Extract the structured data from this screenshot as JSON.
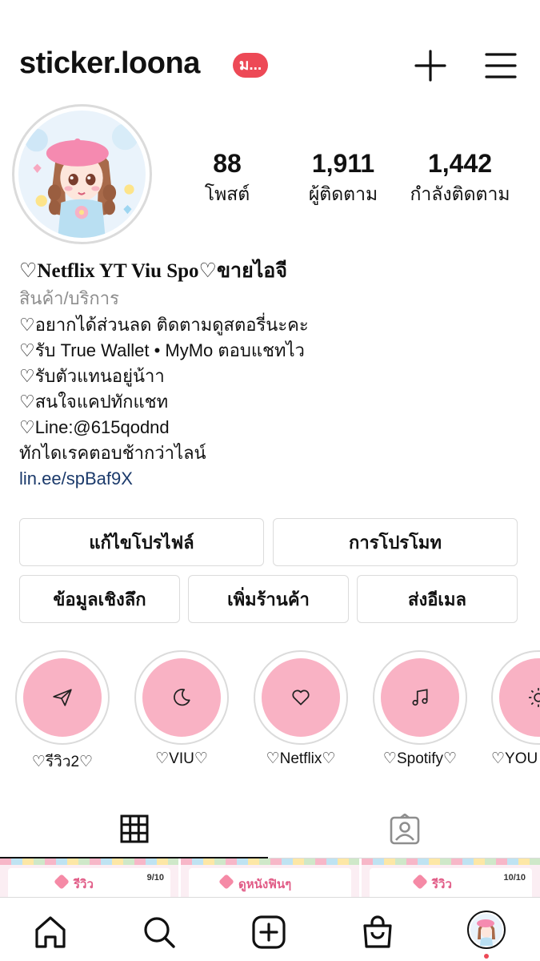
{
  "header": {
    "username": "sticker.loona",
    "notification_badge": "ม...",
    "badge_color": "#ed4956"
  },
  "stats": [
    {
      "value": "88",
      "label": "โพสต์"
    },
    {
      "value": "1,911",
      "label": "ผู้ติดตาม"
    },
    {
      "value": "1,442",
      "label": "กำลังติดตาม"
    }
  ],
  "bio": {
    "name": "♡Netflix YT Viu Spo♡ขายไอจี",
    "category": "สินค้า/บริการ",
    "lines": [
      "♡อยากได้ส่วนลด ติดตามดูสตอรี่นะคะ",
      "♡รับ True Wallet • MyMo ตอบแชทไว",
      "♡รับตัวแทนอยู่น้าา",
      "♡สนใจแคปทักแชท",
      "♡Line:@615qodnd",
      "ทักไดเรคตอบช้ากว่าไลน์"
    ],
    "link": "lin.ee/spBaf9X"
  },
  "buttons": {
    "edit_profile": "แก้ไขโปรไฟล์",
    "promote": "การโปรโมท",
    "insights": "ข้อมูลเชิงลึก",
    "add_shop": "เพิ่มร้านค้า",
    "email": "ส่งอีเมล"
  },
  "highlights": [
    {
      "label": "♡รีวิว2♡",
      "icon": "paper-plane-icon"
    },
    {
      "label": "♡VIU♡",
      "icon": "moon-icon"
    },
    {
      "label": "♡Netflix♡",
      "icon": "heart-icon"
    },
    {
      "label": "♡Spotify♡",
      "icon": "music-note-icon"
    },
    {
      "label": "♡YOU",
      "icon": "sun-icon"
    }
  ],
  "highlight_color": "#f9b2c4",
  "tabs": [
    {
      "name": "posts-grid",
      "icon": "grid-icon",
      "active": true
    },
    {
      "name": "tagged",
      "icon": "tagged-person-icon",
      "active": false
    }
  ],
  "posts": [
    {
      "title": "รีวิว",
      "page": "9/10"
    },
    {
      "title": "ดูหนังฟินๆ",
      "page": ""
    },
    {
      "title": "รีวิว",
      "page": "10/10"
    }
  ],
  "bottom_nav": [
    "home-icon",
    "search-icon",
    "new-post-icon",
    "shop-icon",
    "profile-avatar"
  ]
}
